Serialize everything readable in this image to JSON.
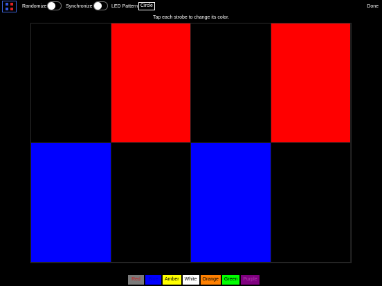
{
  "toolbar": {
    "icon_colors": [
      "#3355dd",
      "#dd2222",
      "#3355dd",
      "#dd2222"
    ],
    "randomize_label": "Randomize",
    "synchronize_label": "Synchronize",
    "led_pattern_label": "LED Pattern",
    "led_pattern_value": "Circle",
    "done_label": "Done"
  },
  "instruction": "Tap each strobe to change its color.",
  "strobes": [
    {
      "row": 1,
      "col": 1,
      "color": "#000000"
    },
    {
      "row": 1,
      "col": 2,
      "color": "#ff0000"
    },
    {
      "row": 1,
      "col": 3,
      "color": "#000000"
    },
    {
      "row": 1,
      "col": 4,
      "color": "#ff0000"
    },
    {
      "row": 2,
      "col": 1,
      "color": "#0000ff"
    },
    {
      "row": 2,
      "col": 2,
      "color": "#000000"
    },
    {
      "row": 2,
      "col": 3,
      "color": "#0000ff"
    },
    {
      "row": 2,
      "col": 4,
      "color": "#000000"
    }
  ],
  "palette": [
    {
      "label": "Red",
      "bg": "#7a7a7a",
      "fg": "#cc2222"
    },
    {
      "label": "Blue",
      "bg": "#0000ff",
      "fg": "#0000cc"
    },
    {
      "label": "Amber",
      "bg": "#ffff00",
      "fg": "#000000"
    },
    {
      "label": "White",
      "bg": "#ffffff",
      "fg": "#000000"
    },
    {
      "label": "Orange",
      "bg": "#ff8000",
      "fg": "#000000"
    },
    {
      "label": "Green",
      "bg": "#00ff00",
      "fg": "#000000"
    },
    {
      "label": "Purple",
      "bg": "#800080",
      "fg": "#b040b0"
    }
  ]
}
